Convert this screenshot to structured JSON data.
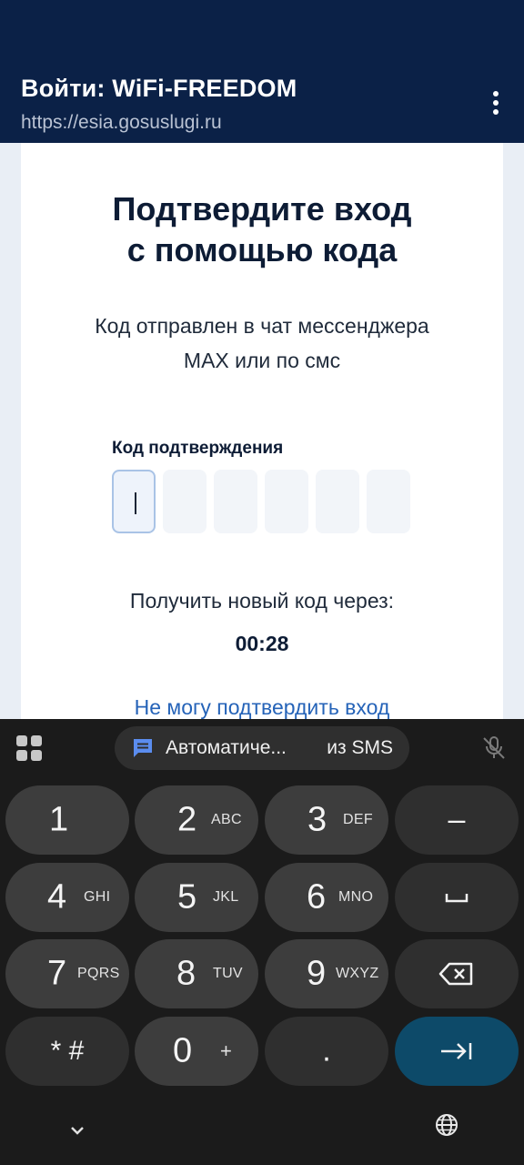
{
  "browser": {
    "title": "Войти: WiFi-FREEDOM",
    "url": "https://esia.gosuslugi.ru",
    "menu_icon": "more-vert-icon"
  },
  "page": {
    "heading_line1": "Подтвердите вход",
    "heading_line2": "с помощью кода",
    "subtitle_line1": "Код отправлен в чат мессенджера",
    "subtitle_line2": "MAX или по смс",
    "code_label": "Код подтверждения",
    "code_digits": [
      "",
      "",
      "",
      "",
      "",
      ""
    ],
    "resend_label": "Получить новый код через:",
    "timer": "00:28",
    "cant_confirm_link": "Не могу подтвердить вход"
  },
  "keyboard": {
    "suggestion_text": "Автоматиче...",
    "suggestion_source": "из SMS",
    "keys": {
      "k1": {
        "num": "1",
        "sub": ""
      },
      "k2": {
        "num": "2",
        "sub": "ABC"
      },
      "k3": {
        "num": "3",
        "sub": "DEF"
      },
      "minus": "–",
      "k4": {
        "num": "4",
        "sub": "GHI"
      },
      "k5": {
        "num": "5",
        "sub": "JKL"
      },
      "k6": {
        "num": "6",
        "sub": "MNO"
      },
      "k7": {
        "num": "7",
        "sub": "PQRS"
      },
      "k8": {
        "num": "8",
        "sub": "TUV"
      },
      "k9": {
        "num": "9",
        "sub": "WXYZ"
      },
      "star_hash": "* #",
      "k0": {
        "num": "0",
        "sub": "+"
      },
      "period": "."
    },
    "colors": {
      "background": "#1b1b1b",
      "key": "#3d3d3d",
      "fn_key": "#2f2f2f",
      "enter_key": "#0d4a69",
      "suggestion_icon": "#5b8def"
    }
  },
  "colors": {
    "header_bg": "#0b2147",
    "link": "#2563b8",
    "heading": "#0d1c35"
  }
}
